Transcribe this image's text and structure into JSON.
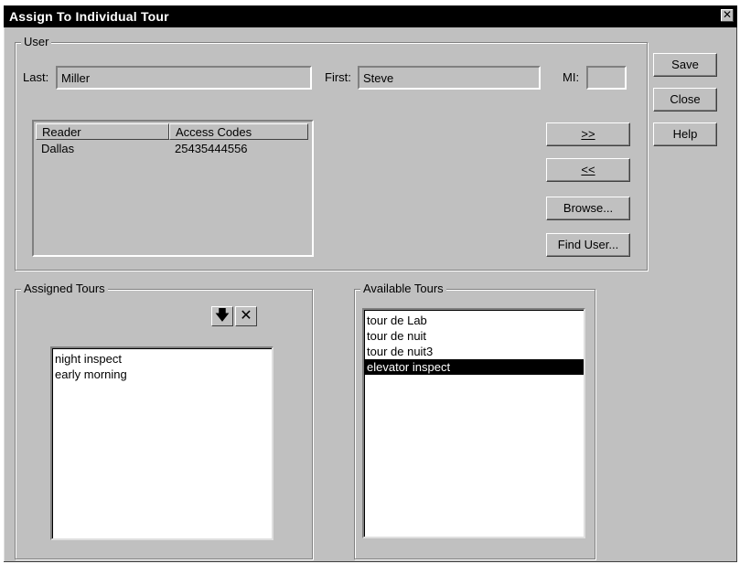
{
  "window": {
    "title": "Assign To Individual Tour",
    "close_glyph": "✕"
  },
  "user_group": {
    "label": "User",
    "last_label": "Last:",
    "last_value": "Miller",
    "first_label": "First:",
    "first_value": "Steve",
    "mi_label": "MI:",
    "mi_value": ""
  },
  "reader_grid": {
    "columns": [
      "Reader",
      "Access Codes"
    ],
    "rows": [
      {
        "reader": "Dallas",
        "access_codes": "25435444556"
      }
    ]
  },
  "buttons": {
    "save": "Save",
    "close": "Close",
    "help": "Help",
    "add": ">>",
    "remove": "<<",
    "browse": "Browse...",
    "find_user": "Find User..."
  },
  "assigned_tours": {
    "label": "Assigned Tours",
    "items": [
      "night inspect",
      "early morning"
    ],
    "tool_down_icon": "arrow-down-icon",
    "tool_delete_icon": "delete-x-icon"
  },
  "available_tours": {
    "label": "Available Tours",
    "items": [
      "tour de Lab",
      "tour de nuit",
      "tour de nuit3",
      "elevator inspect"
    ],
    "selected_index": 3
  }
}
